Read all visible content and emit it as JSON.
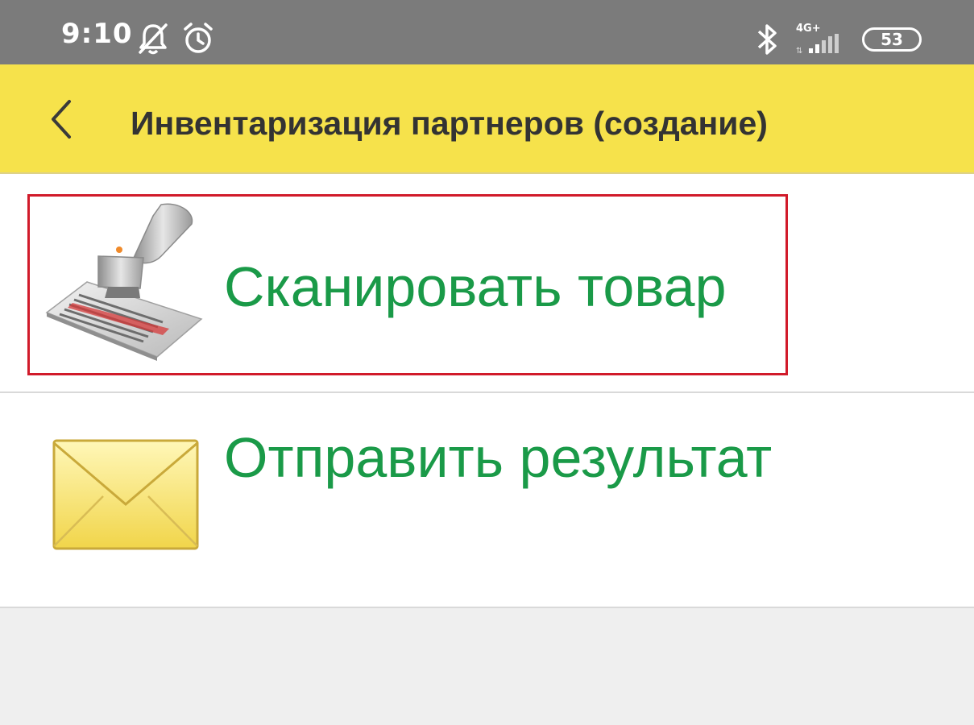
{
  "status_bar": {
    "time": "9:10",
    "network_label": "4G+",
    "battery": "53",
    "icons": [
      "bell-off-icon",
      "alarm-icon",
      "bluetooth-icon",
      "signal-icon"
    ]
  },
  "header": {
    "title": "Инвентаризация партнеров (создание)",
    "background_color": "#f6e24b"
  },
  "menu": {
    "items": [
      {
        "label": "Сканировать товар",
        "icon": "barcode-scanner-icon",
        "highlighted": true
      },
      {
        "label": "Отправить результат",
        "icon": "envelope-icon",
        "highlighted": false
      }
    ],
    "label_color": "#1a9a48",
    "highlight_color": "#d11a2a"
  }
}
